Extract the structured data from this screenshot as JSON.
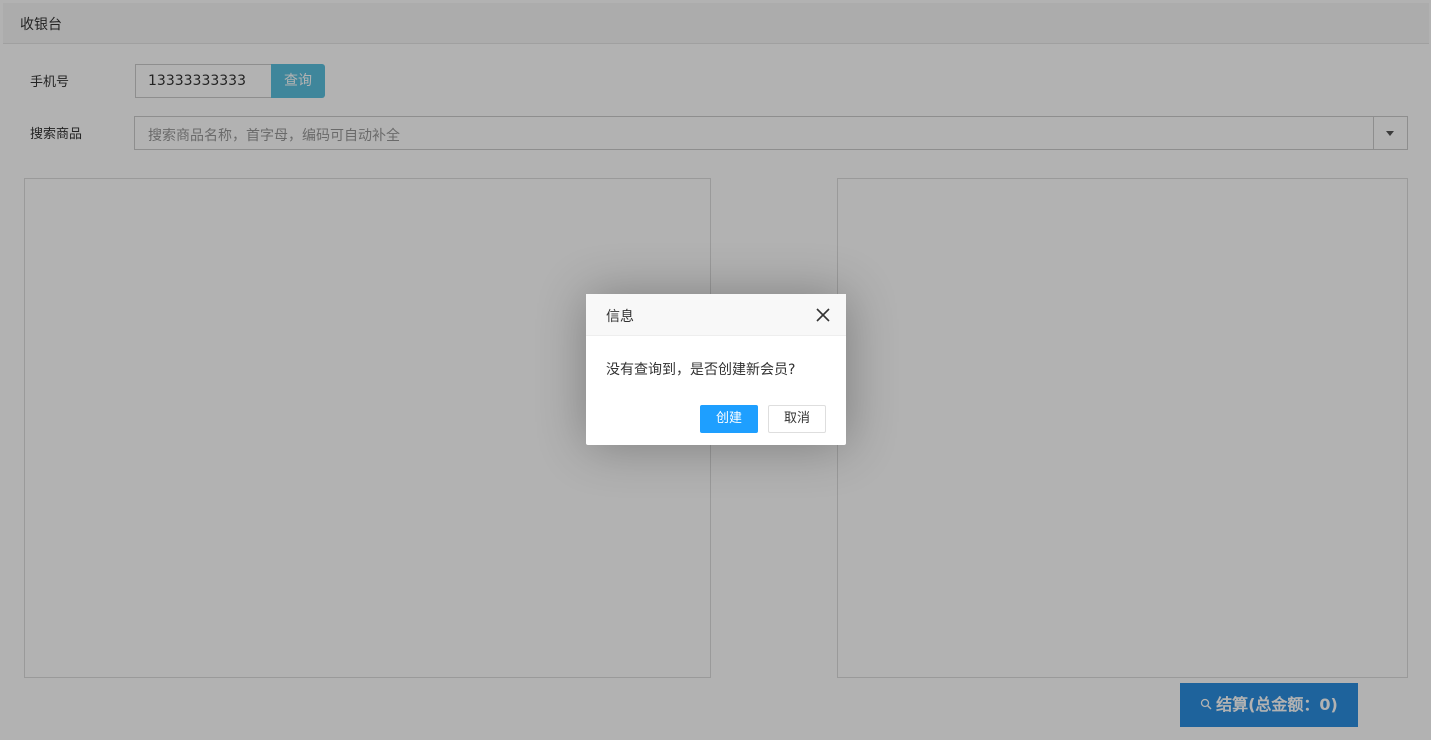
{
  "panel": {
    "title": "收银台"
  },
  "form": {
    "phone_label": "手机号",
    "phone_value": "13333333333",
    "query_button": "查询",
    "search_label": "搜索商品",
    "search_placeholder": "搜索商品名称，首字母，编码可自动补全"
  },
  "checkout": {
    "label": "结算(总金额：0)",
    "icon": "search-icon"
  },
  "dialog": {
    "title": "信息",
    "message": "没有查询到，是否创建新会员?",
    "create_button": "创建",
    "cancel_button": "取消",
    "close_icon": "close-icon"
  },
  "colors": {
    "query_button": "#5bc0de",
    "checkout_button": "#2b8fe0",
    "create_button": "#1e9fff",
    "overlay": "rgba(0,0,0,0.3)"
  }
}
